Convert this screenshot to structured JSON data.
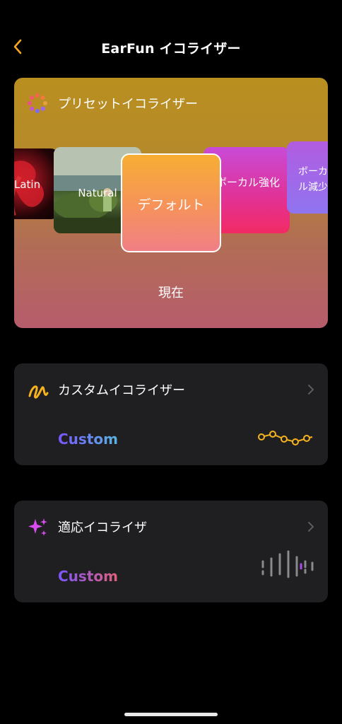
{
  "header": {
    "title": "EarFun イコライザー"
  },
  "preset": {
    "title": "プリセットイコライザー",
    "tiles": {
      "latin": "Latin",
      "natural": "Natural",
      "default": "デフォルト",
      "vocal_boost": "ボーカル強化",
      "vocal_less": "ボーカル減少"
    },
    "current_label": "現在"
  },
  "custom_eq": {
    "title": "カスタムイコライザー",
    "value": "Custom"
  },
  "adaptive_eq": {
    "title": "適応イコライザ",
    "value": "Custom"
  },
  "colors": {
    "accent": "#f6a623",
    "background": "#000000",
    "card": "#1f1f21"
  }
}
